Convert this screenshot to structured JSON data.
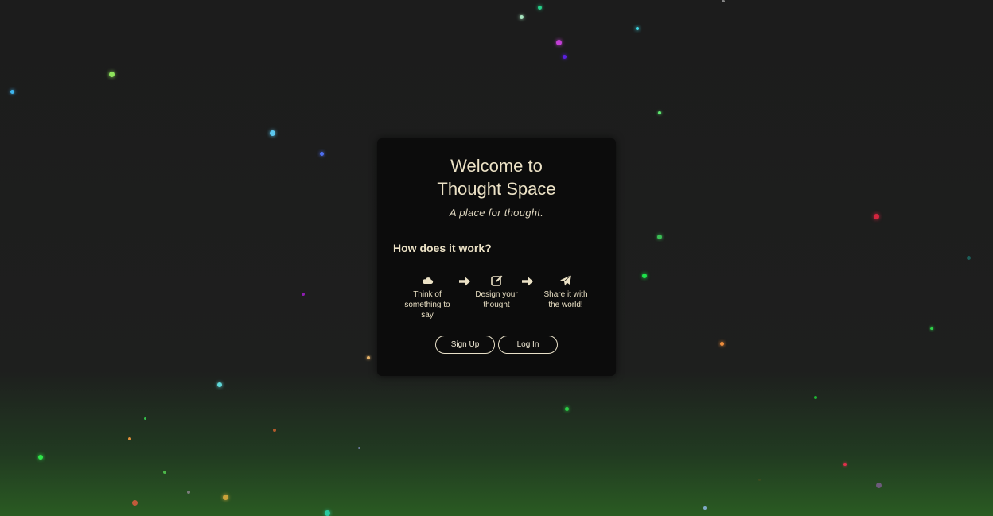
{
  "card": {
    "title_line1": "Welcome to",
    "title_line2": "Thought Space",
    "tagline": "A place for thought.",
    "how_heading": "How does it work?",
    "steps": [
      {
        "icon": "cloud-icon",
        "label": "Think of something to say"
      },
      {
        "icon": "edit-icon",
        "label": "Design your thought"
      },
      {
        "icon": "paper-plane-icon",
        "label": "Share it with the world!"
      }
    ],
    "buttons": {
      "signup": "Sign Up",
      "login": "Log In"
    }
  },
  "colors": {
    "background_top": "#1c1c1c",
    "background_bottom": "#2a5b22",
    "card": "#0c0c0c",
    "text": "#ece2c6"
  }
}
